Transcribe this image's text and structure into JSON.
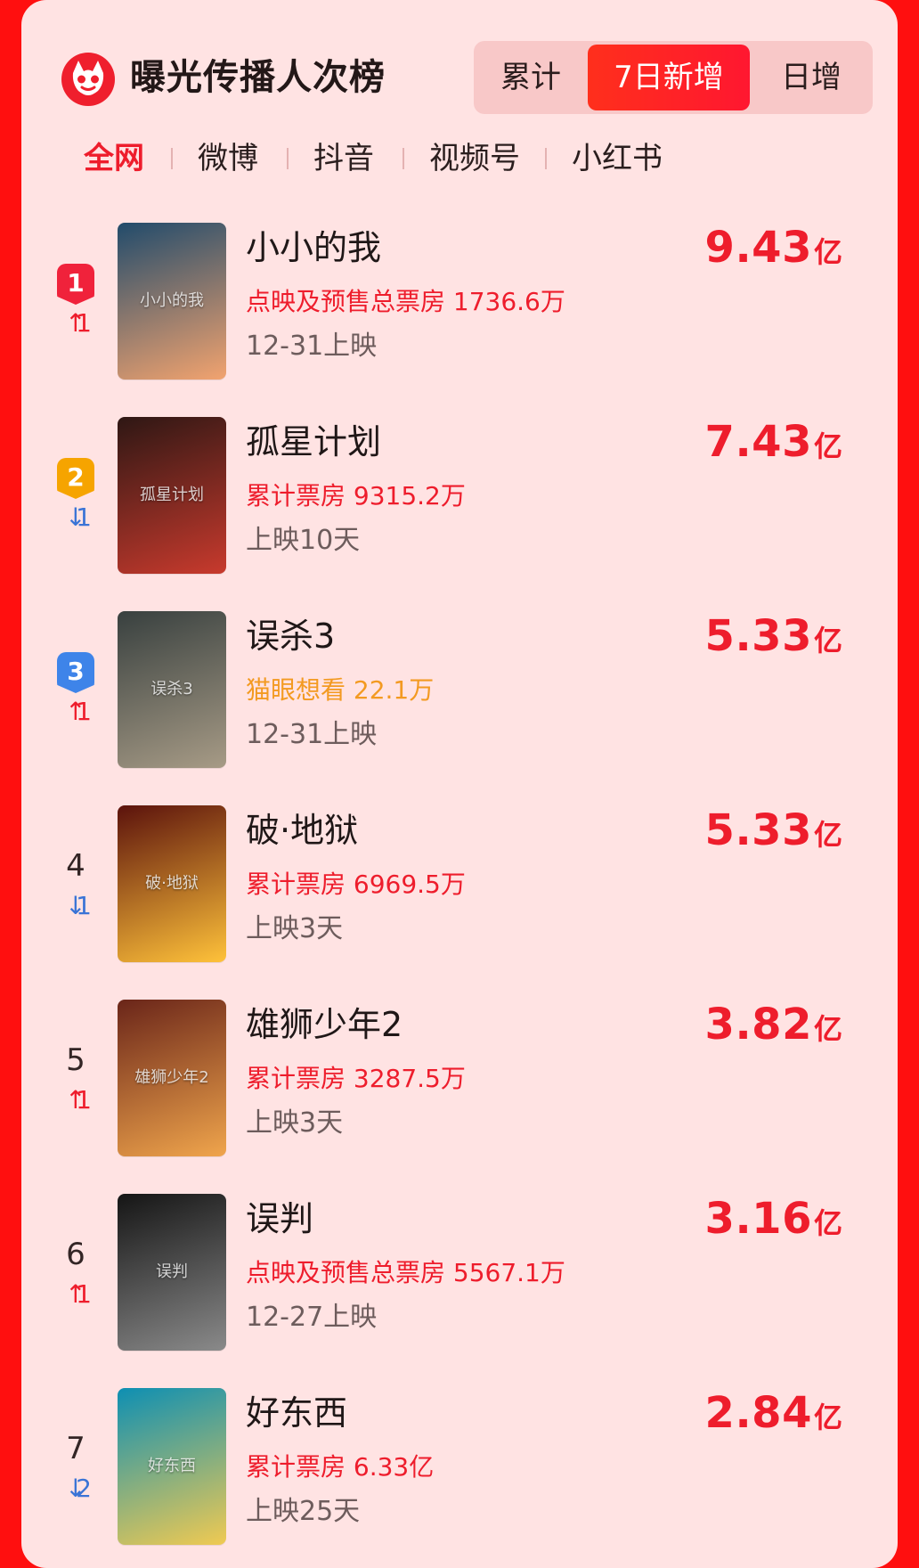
{
  "header": {
    "title": "曝光传播人次榜",
    "segments": [
      "累计",
      "7日新增",
      "日增"
    ],
    "active_segment": 1
  },
  "tabs": [
    "全网",
    "微博",
    "抖音",
    "视频号",
    "小红书"
  ],
  "active_tab": 0,
  "movies": [
    {
      "rank": "1",
      "change": "1",
      "direction": "up",
      "title": "小小的我",
      "info": "点映及预售总票房 1736.6万",
      "info_color": "#ee1d2c",
      "date": "12-31上映",
      "value": "9.43",
      "unit": "亿",
      "poster_theme": [
        "#214b6b",
        "#f2a36f"
      ]
    },
    {
      "rank": "2",
      "change": "1",
      "direction": "down",
      "title": "孤星计划",
      "info": "累计票房 9315.2万",
      "info_color": "#ee1d2c",
      "date": "上映10天",
      "value": "7.43",
      "unit": "亿",
      "poster_theme": [
        "#2e1714",
        "#c83a2d"
      ]
    },
    {
      "rank": "3",
      "change": "1",
      "direction": "up",
      "title": "误杀3",
      "info": "猫眼想看 22.1万",
      "info_color": "#f39a21",
      "date": "12-31上映",
      "value": "5.33",
      "unit": "亿",
      "poster_theme": [
        "#38403f",
        "#a79b86"
      ]
    },
    {
      "rank": "4",
      "change": "1",
      "direction": "down",
      "title": "破·地狱",
      "info": "累计票房 6969.5万",
      "info_color": "#ee1d2c",
      "date": "上映3天",
      "value": "5.33",
      "unit": "亿",
      "poster_theme": [
        "#5b120c",
        "#ffc23a"
      ]
    },
    {
      "rank": "5",
      "change": "1",
      "direction": "up",
      "title": "雄狮少年2",
      "info": "累计票房 3287.5万",
      "info_color": "#ee1d2c",
      "date": "上映3天",
      "value": "3.82",
      "unit": "亿",
      "poster_theme": [
        "#6a2519",
        "#f0a54c"
      ]
    },
    {
      "rank": "6",
      "change": "1",
      "direction": "up",
      "title": "误判",
      "info": "点映及预售总票房 5567.1万",
      "info_color": "#ee1d2c",
      "date": "12-27上映",
      "value": "3.16",
      "unit": "亿",
      "poster_theme": [
        "#151515",
        "#8a8a8a"
      ]
    },
    {
      "rank": "7",
      "change": "2",
      "direction": "down",
      "title": "好东西",
      "info": "累计票房 6.33亿",
      "info_color": "#ee1d2c",
      "date": "上映25天",
      "value": "2.84",
      "unit": "亿",
      "poster_theme": [
        "#0d8fb3",
        "#f0ca52"
      ]
    }
  ]
}
